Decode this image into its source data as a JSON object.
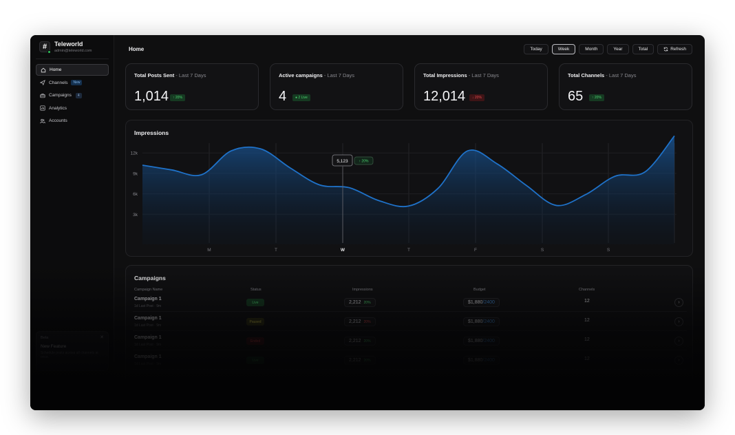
{
  "brand": {
    "name": "Teleworld",
    "email": "admin@teleworld.com",
    "logo_glyph": "#"
  },
  "sidebar": {
    "items": [
      {
        "label": "Home",
        "icon": "home-icon",
        "active": true
      },
      {
        "label": "Channels",
        "icon": "send-icon",
        "badge": "New"
      },
      {
        "label": "Campaigns",
        "icon": "briefcase-icon",
        "count": "4"
      },
      {
        "label": "Analytics",
        "icon": "chart-icon"
      },
      {
        "label": "Accounts",
        "icon": "users-icon"
      }
    ],
    "promo": {
      "tag": "Beta",
      "title": "New Feature",
      "text": "Schedule posts across all channels at once."
    }
  },
  "header": {
    "title": "Home",
    "filters": [
      {
        "label": "Today",
        "active": false
      },
      {
        "label": "Week",
        "active": true
      },
      {
        "label": "Month",
        "active": false
      },
      {
        "label": "Year",
        "active": false
      },
      {
        "label": "Total",
        "active": false
      }
    ],
    "refresh_label": "Refresh"
  },
  "stats": [
    {
      "title": "Total Posts Sent",
      "period": " - Last 7 Days",
      "value": "1,014",
      "badge": "20%",
      "trend": "up",
      "color": "#4cd46f"
    },
    {
      "title": "Active campaigns",
      "period": " - Last 7 Days",
      "value": "4",
      "badge": "2 Live",
      "trend": "live",
      "color": "#4cd46f"
    },
    {
      "title": "Total Impressions",
      "period": " - Last 7 Days",
      "value": "12,014",
      "badge": "20%",
      "trend": "down",
      "color": "#e5484d"
    },
    {
      "title": "Total Channels",
      "period": " - Last 7 Days",
      "value": "65",
      "badge": "20%",
      "trend": "up",
      "color": "#4cd46f"
    }
  ],
  "chart_data": {
    "type": "area",
    "title": "Impressions",
    "x": [
      "M",
      "T",
      "W",
      "T",
      "F",
      "S",
      "S"
    ],
    "y_ticks": [
      "12k",
      "9k",
      "6k",
      "3k"
    ],
    "ylim": [
      0,
      15000
    ],
    "series": [
      {
        "values": [
          10200,
          9500,
          8800,
          12300,
          12600,
          9800,
          7300,
          6900,
          5000,
          4200,
          6800,
          12300,
          10400,
          7200,
          4300,
          5900,
          8600,
          9200,
          14500
        ]
      }
    ],
    "tooltip": {
      "day": "W",
      "value": "5,123",
      "change": "20%"
    },
    "line_color": "#1f72c9",
    "grid": true
  },
  "campaigns": {
    "title": "Campaigns",
    "columns": [
      "Campaign Name",
      "Status",
      "Impressions",
      "Budget",
      "Channels"
    ],
    "rows": [
      {
        "name": "Campaign 1",
        "meta": "1d Last Post · 9m",
        "status": "Live",
        "state": "live",
        "impressions": "2,212",
        "pct": "20%",
        "pct_color": "#4cd46f",
        "spent": "$1,880",
        "total": "/2400",
        "channels": "12"
      },
      {
        "name": "Campaign 1",
        "meta": "1d Last Post · 9m",
        "status": "Paused",
        "state": "paused",
        "impressions": "2,212",
        "pct": "20%",
        "pct_color": "#e5484d",
        "spent": "$1,880",
        "total": "/2400",
        "channels": "12"
      },
      {
        "name": "Campaign 1",
        "meta": "1d Last Post · 9m",
        "status": "Ended",
        "state": "ended",
        "impressions": "2,212",
        "pct": "20%",
        "pct_color": "#4cd46f",
        "spent": "$1,880",
        "total": "/2400",
        "channels": "12"
      },
      {
        "name": "Campaign 1",
        "meta": "1d Last Post · 9m",
        "status": "Live",
        "state": "live",
        "impressions": "2,212",
        "pct": "20%",
        "pct_color": "#4cd46f",
        "spent": "$1,880",
        "total": "/2400",
        "channels": "12"
      }
    ]
  }
}
